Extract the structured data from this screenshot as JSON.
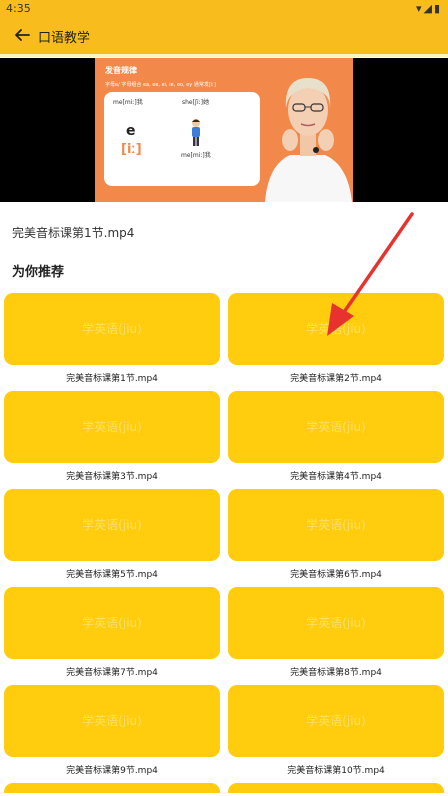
{
  "status": {
    "time": "4:35"
  },
  "appbar": {
    "title": "口语教学"
  },
  "video": {
    "heading": "发音规律",
    "subtitle": "字母e/ 字母组合 ea, ee, ei, ie, eo, ey 通常发[iː]",
    "word1": "me[miː]我",
    "word2": "she[ʃiː]她",
    "letter": "e",
    "ipa": "[iː]",
    "word3": "me[miː]我"
  },
  "current_file": "完美音标课第1节.mp4",
  "section_title": "为你推荐",
  "watermark": "学英语(jiu)",
  "items": [
    {
      "caption": "完美音标课第1节.mp4"
    },
    {
      "caption": "完美音标课第2节.mp4"
    },
    {
      "caption": "完美音标课第3节.mp4"
    },
    {
      "caption": "完美音标课第4节.mp4"
    },
    {
      "caption": "完美音标课第5节.mp4"
    },
    {
      "caption": "完美音标课第6节.mp4"
    },
    {
      "caption": "完美音标课第7节.mp4"
    },
    {
      "caption": "完美音标课第8节.mp4"
    },
    {
      "caption": "完美音标课第9节.mp4"
    },
    {
      "caption": "完美音标课第10节.mp4"
    }
  ],
  "colors": {
    "accent": "#f8bd1c",
    "tile": "#ffcc0e",
    "arrow": "#e8322d"
  }
}
